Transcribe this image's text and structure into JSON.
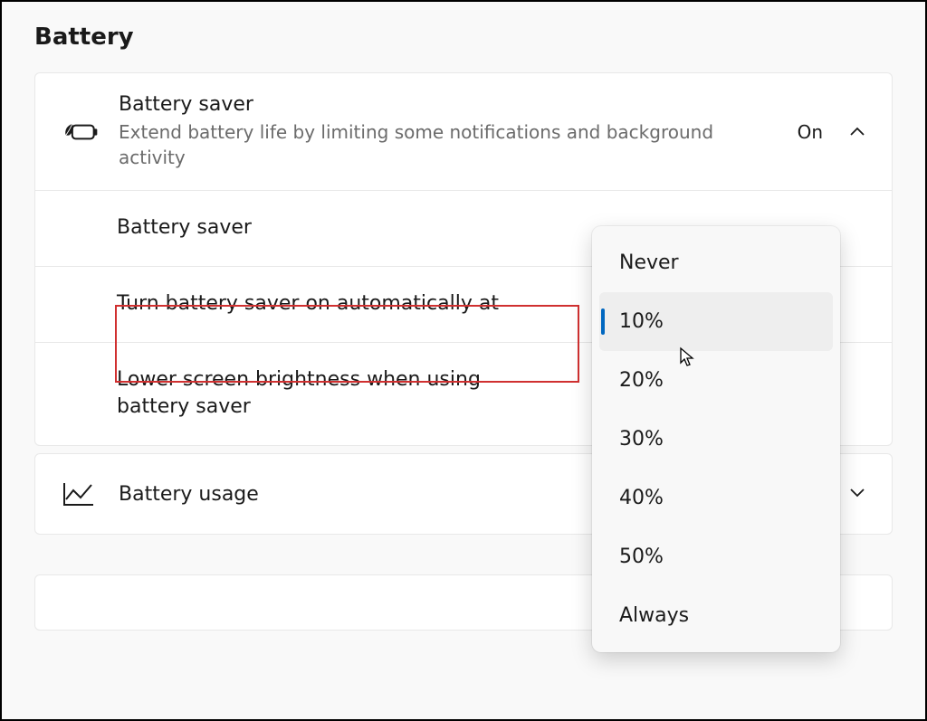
{
  "page": {
    "title": "Battery"
  },
  "batterySaver": {
    "title": "Battery saver",
    "subtitle": "Extend battery life by limiting some notifications and background activity",
    "status": "On",
    "expanded": true,
    "rows": {
      "toggle": "Battery saver",
      "autoOn": "Turn battery saver on automatically at",
      "lowerBrightness": "Lower screen brightness when using battery saver"
    }
  },
  "batteryUsage": {
    "title": "Battery usage",
    "expanded": false
  },
  "dropdown": {
    "options": [
      "Never",
      "10%",
      "20%",
      "30%",
      "40%",
      "50%",
      "Always"
    ],
    "selectedIndex": 1
  }
}
